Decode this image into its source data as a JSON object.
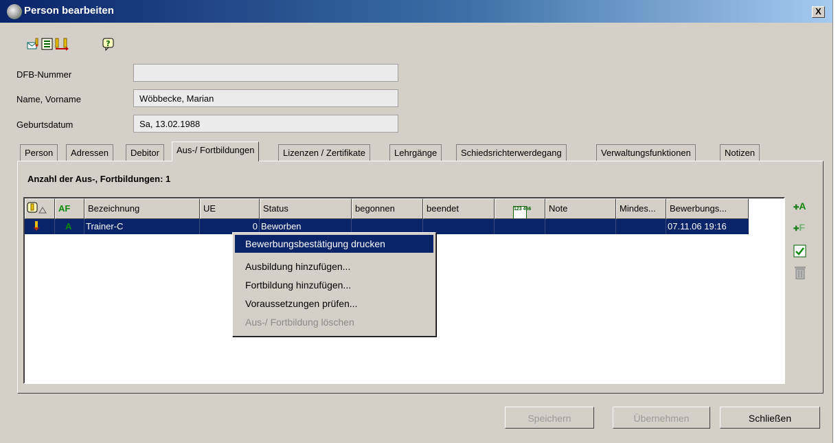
{
  "window": {
    "title": "Person bearbeiten",
    "close_label": "X"
  },
  "toolbar": {
    "icons": [
      "mail-check-icon",
      "list-icon",
      "export-icon",
      "help-icon"
    ],
    "help_glyph": "?"
  },
  "form": {
    "dfb_label": "DFB-Nummer",
    "dfb_value": "",
    "name_label": "Name, Vorname",
    "name_value": "Wöbbecke, Marian",
    "birth_label": "Geburtsdatum",
    "birth_value": "Sa, 13.02.1988"
  },
  "tabs": [
    {
      "label": "Person"
    },
    {
      "label": "Adressen"
    },
    {
      "label": "Debitor"
    },
    {
      "label": "Aus-/ Fortbildungen",
      "active": true
    },
    {
      "label": "Lizenzen / Zertifikate"
    },
    {
      "label": "Lehrgänge"
    },
    {
      "label": "Schiedsrichterwerdegang"
    },
    {
      "label": "Verwaltungsfunktionen"
    },
    {
      "label": "Notizen"
    }
  ],
  "panel": {
    "count_label": "Anzahl der Aus-, Fortbildungen: 1",
    "columns": {
      "col_af": "AF",
      "bezeichnung": "Bezeichnung",
      "ue": "UE",
      "status": "Status",
      "begonnen": "begonnen",
      "beendet": "beendet",
      "num_icon": "123 456",
      "note": "Note",
      "mindes": "Mindes...",
      "bewerbung": "Bewerbungs..."
    },
    "row": {
      "type_glyph": "A",
      "bezeichnung": "Trainer-C",
      "ue": "0",
      "status": "Beworben",
      "begonnen": "",
      "beendet": "",
      "note": "",
      "mindes": "",
      "bewerbung": "07.11.06 19:16"
    },
    "side_actions": {
      "add_a": "A",
      "add_f": "F"
    }
  },
  "context_menu": {
    "items": [
      {
        "label": "Bewerbungsbestätigung drucken"
      },
      {
        "label": "Ausbildung hinzufügen..."
      },
      {
        "label": "Fortbildung hinzufügen..."
      },
      {
        "label": "Voraussetzungen prüfen..."
      },
      {
        "label": "Aus-/ Fortbildung löschen"
      }
    ]
  },
  "buttons": {
    "save": "Speichern",
    "apply": "Übernehmen",
    "close": "Schließen"
  },
  "colors": {
    "selection": "#0a246a",
    "title_start": "#0a246a",
    "title_end": "#a6caf0",
    "face": "#d4d0c8"
  }
}
